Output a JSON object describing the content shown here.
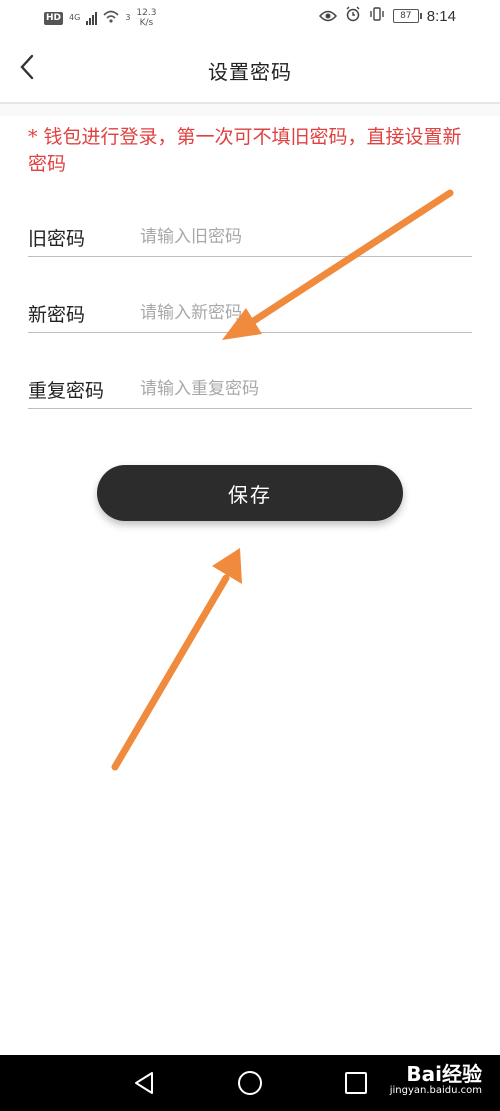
{
  "status_bar": {
    "hd": "HD",
    "network": "4G",
    "speed_value": "12.3",
    "speed_unit": "K/s",
    "wifi_badge": "3",
    "battery": "87",
    "time": "8:14"
  },
  "header": {
    "title": "设置密码"
  },
  "notice": "* 钱包进行登录，第一次可不填旧密码，直接设置新密码",
  "form": {
    "old_password": {
      "label": "旧密码",
      "placeholder": "请输入旧密码"
    },
    "new_password": {
      "label": "新密码",
      "placeholder": "请输入新密码"
    },
    "repeat_password": {
      "label": "重复密码",
      "placeholder": "请输入重复密码"
    }
  },
  "save_button": "保存",
  "watermark": {
    "brand": "Bai经验",
    "url": "jingyan.baidu.com"
  },
  "colors": {
    "notice": "#e04141",
    "button": "#2c2c2c",
    "arrow": "#f08a3c"
  }
}
